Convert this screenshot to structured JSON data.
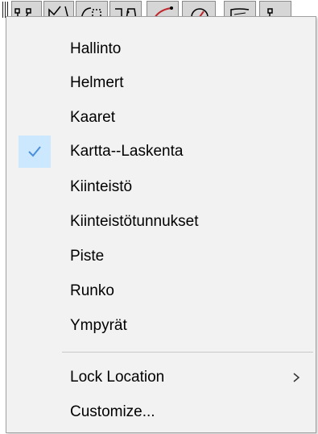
{
  "toolbar": {
    "buttons": [
      {
        "icon": "point-line-icon"
      },
      {
        "icon": "polyline-icon"
      },
      {
        "icon": "measure-angle-icon"
      },
      {
        "icon": "boundary-icon"
      },
      {
        "icon": "arc-icon"
      },
      {
        "icon": "gauge-icon"
      },
      {
        "icon": "curve-icon"
      },
      {
        "icon": "point-marker-icon"
      }
    ]
  },
  "menu": {
    "items": [
      {
        "label": "Hallinto",
        "checked": false
      },
      {
        "label": "Helmert",
        "checked": false
      },
      {
        "label": "Kaaret",
        "checked": false
      },
      {
        "label": "Kartta--Laskenta",
        "checked": true
      },
      {
        "label": "Kiinteistö",
        "checked": false
      },
      {
        "label": "Kiinteistötunnukset",
        "checked": false
      },
      {
        "label": "Piste",
        "checked": false
      },
      {
        "label": "Runko",
        "checked": false
      },
      {
        "label": "Ympyrät",
        "checked": false
      }
    ],
    "lock_location_label": "Lock Location",
    "customize_label": "Customize..."
  },
  "colors": {
    "menu_background": "#f2f2f2",
    "check_highlight": "#cce8ff",
    "check_mark": "#4a8fd8",
    "separator": "#c8c8c8"
  }
}
